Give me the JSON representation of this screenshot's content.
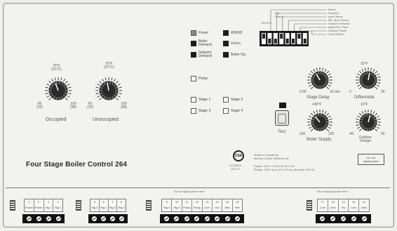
{
  "indicators": {
    "power": "Power",
    "boiler_demand": "Boiler\nDemand",
    "setpoint_demand": "Setpoint\nDemand",
    "warm_weather": "WWSD",
    "unoccupied": "Unocc.",
    "boiler_operating": "Boiler Op.",
    "pump": "Pump",
    "stage1": "Stage 1",
    "stage2": "Stage 2",
    "stage3": "Stage 3",
    "stage4": "Stage 4"
  },
  "dials": {
    "occupied": {
      "label": "Occupied",
      "top_value": "70°F\n(21°C)",
      "left_value": "50\n(10)",
      "right_value": "100\n(38)"
    },
    "unoccupied": {
      "label": "Unoccupied",
      "top_value": "70°F\n(21°C)",
      "left_value": "50\n(10)",
      "right_value": "100\n(38)"
    },
    "rotation_delay": {
      "label": "Stage Delay",
      "left_value": "0:30",
      "right_value": "10 min"
    },
    "differential": {
      "label": "Differential",
      "top_value": "15°F",
      "left_value": "2",
      "right_value": "30"
    },
    "boiler_supply": {
      "label": "Boiler Supply",
      "top_value": "140°F",
      "left_value": "100",
      "right_value": "220"
    },
    "outdoor_design": {
      "label": "Outdoor\nDesign",
      "top_value": "10°F",
      "left_value": "-40",
      "right_value": "50"
    }
  },
  "dip": {
    "header": "Dip\nSwitch",
    "sub": "ON   OFF",
    "labels": [
      "Boost",
      "Rotation",
      "Auto Sense",
      "Min. Boil. Return",
      "Setpoint Demand",
      "Equal Run Time",
      "Outdoor Reset",
      "Fixed Return"
    ]
  },
  "test": {
    "label": "Test"
  },
  "product": {
    "title": "Four Stage Boiler Control 264"
  },
  "cert": {
    "mark": "CSA",
    "text": "LR 58223\nUS & C"
  },
  "info": {
    "made": "Made in Canada by",
    "company": "tekmar Control Systems Ltd.",
    "power_line": "Power:  120 V ± 10%  60 Hz 3 VA",
    "relays_line": "Relays:  240 V (ac) 10 A 1/3 hp, pilot duty 240 VA"
  },
  "badge": {
    "text": "Do not\napply power"
  },
  "terminals": {
    "inputs_header": "Do not apply power here",
    "outputs_header": "Do not apply power here",
    "group1": [
      {
        "num": "1",
        "lab": "Power"
      },
      {
        "num": "2",
        "lab": "Power"
      },
      {
        "num": "3",
        "lab": "Stg 1"
      },
      {
        "num": "4",
        "lab": "Stg 1"
      }
    ],
    "group2": [
      {
        "num": "5",
        "lab": "Stg 2"
      },
      {
        "num": "6",
        "lab": "Stg 2"
      },
      {
        "num": "7",
        "lab": "Stg 3"
      },
      {
        "num": "8",
        "lab": "Stg 3"
      }
    ],
    "group3": [
      {
        "num": "9",
        "lab": "Stg 4"
      },
      {
        "num": "10",
        "lab": "Stg 4"
      },
      {
        "num": "11",
        "lab": "Pump"
      },
      {
        "num": "12",
        "lab": "Pump"
      },
      {
        "num": "13",
        "lab": "Com"
      },
      {
        "num": "14",
        "lab": "Out"
      },
      {
        "num": "15",
        "lab": "Boil"
      },
      {
        "num": "16",
        "lab": "Ret"
      }
    ],
    "group4": [
      {
        "num": "17",
        "lab": "Com"
      },
      {
        "num": "18",
        "lab": "UnO"
      },
      {
        "num": "19",
        "lab": "Sw"
      },
      {
        "num": "20",
        "lab": "Com"
      },
      {
        "num": "21",
        "lab": "Dem"
      }
    ]
  }
}
